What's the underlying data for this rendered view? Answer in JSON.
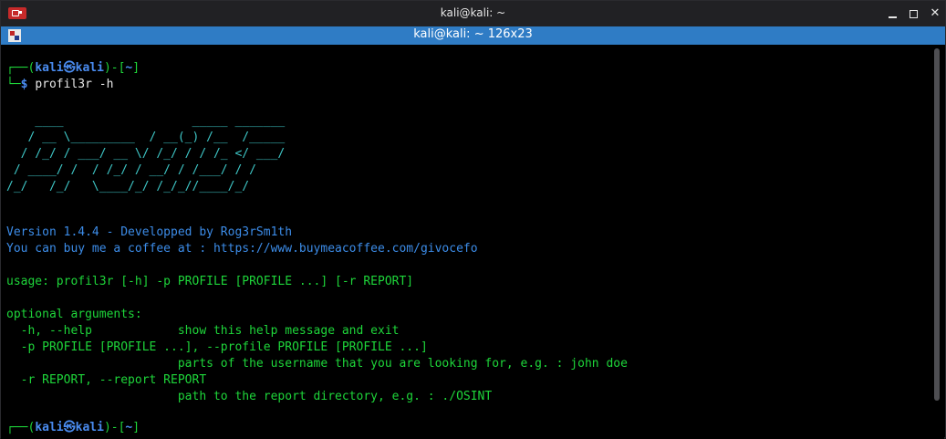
{
  "window": {
    "title": "kali@kali: ~",
    "tab_title": "kali@kali: ~ 126x23",
    "app_icon": "terminal-app-icon",
    "controls": {
      "minimize_icon": "minimize-icon",
      "maximize_icon": "maximize-icon",
      "close_label": "✕"
    }
  },
  "terminal": {
    "prompt1": {
      "top": "┌──(",
      "user": "kali㉿kali",
      "mid": ")-[",
      "dir": "~",
      "end": "]",
      "bottom": "└─",
      "dollar": "$ ",
      "command": "profil3r -h"
    },
    "banner": [
      "    ____                  _____ _______",
      "   / __ \\_________  / __(_) /__  /_____",
      "  / /_/ / ___/ __ \\/ /_/ / / /_ </ ___/",
      " / ____/ /  / /_/ / __/ / /___/ / /",
      "/_/   /_/   \\____/_/ /_/_//____/_/"
    ],
    "version": "Version 1.4.4 - Developped by Rog3rSm1th",
    "coffee": "You can buy me a coffee at : https://www.buymeacoffee.com/givocefo",
    "usage": "usage: profil3r [-h] -p PROFILE [PROFILE ...] [-r REPORT]",
    "optional_header": "optional arguments:",
    "help_lines": [
      "  -h, --help            show this help message and exit",
      "  -p PROFILE [PROFILE ...], --profile PROFILE [PROFILE ...]",
      "                        parts of the username that you are looking for, e.g. : john doe",
      "  -r REPORT, --report REPORT",
      "                        path to the report directory, e.g. : ./OSINT"
    ],
    "prompt2": {
      "top": "┌──(",
      "user": "kali㉿kali",
      "mid": ")-[",
      "dir": "~",
      "end": "]"
    }
  }
}
